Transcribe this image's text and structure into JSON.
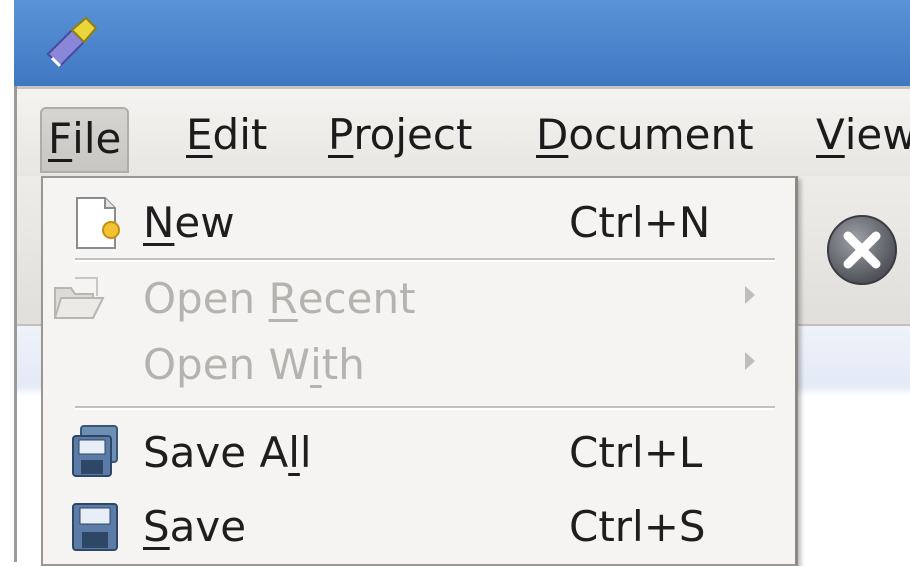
{
  "window": {
    "app_icon": "kate-editor-icon"
  },
  "menubar": {
    "items": [
      {
        "mnemonic": "F",
        "rest": "ile",
        "active": true
      },
      {
        "mnemonic": "E",
        "rest": "dit"
      },
      {
        "mnemonic": "P",
        "rest": "roject"
      },
      {
        "mnemonic": "D",
        "rest": "ocument"
      },
      {
        "mnemonic": "V",
        "rest": "iew"
      }
    ]
  },
  "toolbar": {
    "close_icon": "close-document-icon"
  },
  "file_menu": {
    "items": [
      {
        "pre": "",
        "mnemonic": "N",
        "post": "ew",
        "shortcut": "Ctrl+N",
        "icon": "new-document-icon",
        "enabled": true
      },
      {
        "pre": "Open ",
        "mnemonic": "R",
        "post": "ecent",
        "shortcut": "",
        "icon": "open-folder-icon",
        "enabled": false,
        "submenu": true
      },
      {
        "pre": "Open W",
        "mnemonic": "i",
        "post": "th",
        "shortcut": "",
        "icon": "",
        "enabled": false,
        "submenu": true
      },
      {
        "pre": "Save A",
        "mnemonic": "l",
        "post": "l",
        "shortcut": "Ctrl+L",
        "icon": "save-all-icon",
        "enabled": true
      },
      {
        "pre": "",
        "mnemonic": "S",
        "post": "ave",
        "shortcut": "Ctrl+S",
        "icon": "save-icon",
        "enabled": true
      }
    ]
  }
}
